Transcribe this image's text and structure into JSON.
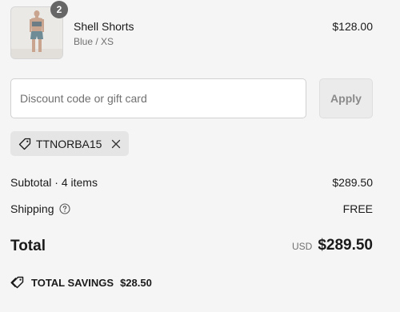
{
  "product": {
    "quantity_badge": "2",
    "title": "Shell Shorts",
    "variant": "Blue / XS",
    "price": "$128.00",
    "image_icon": "product-thumbnail"
  },
  "discount": {
    "placeholder": "Discount code or gift card",
    "value": "",
    "apply_label": "Apply",
    "applied_code": "TTNORBA15"
  },
  "summary": {
    "subtotal_label": "Subtotal · 4 items",
    "subtotal_value": "$289.50",
    "shipping_label": "Shipping",
    "shipping_value": "FREE",
    "total_label": "Total",
    "currency": "USD",
    "total_value": "$289.50",
    "savings_label": "TOTAL SAVINGS",
    "savings_value": "$28.50"
  },
  "colors": {
    "background": "#f5f5f5",
    "badge": "#666666",
    "muted_text": "#707070",
    "chip": "#e5e5e5"
  }
}
